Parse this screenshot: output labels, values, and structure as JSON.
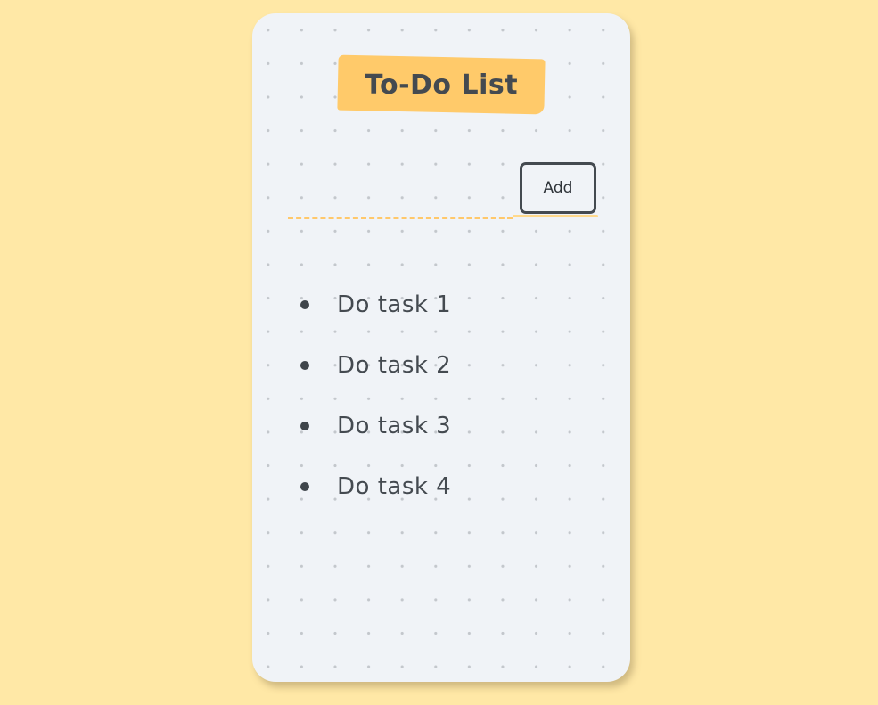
{
  "app": {
    "title": "To-Do List"
  },
  "form": {
    "input_value": "",
    "input_placeholder": "",
    "add_label": "Add"
  },
  "tasks": [
    {
      "label": "Do task 1"
    },
    {
      "label": "Do task 2"
    },
    {
      "label": "Do task 3"
    },
    {
      "label": "Do task 4"
    }
  ],
  "colors": {
    "page_background": "#ffe8a6",
    "card_background": "#f0f3f7",
    "accent": "#ffca6a",
    "text": "#444a50"
  }
}
